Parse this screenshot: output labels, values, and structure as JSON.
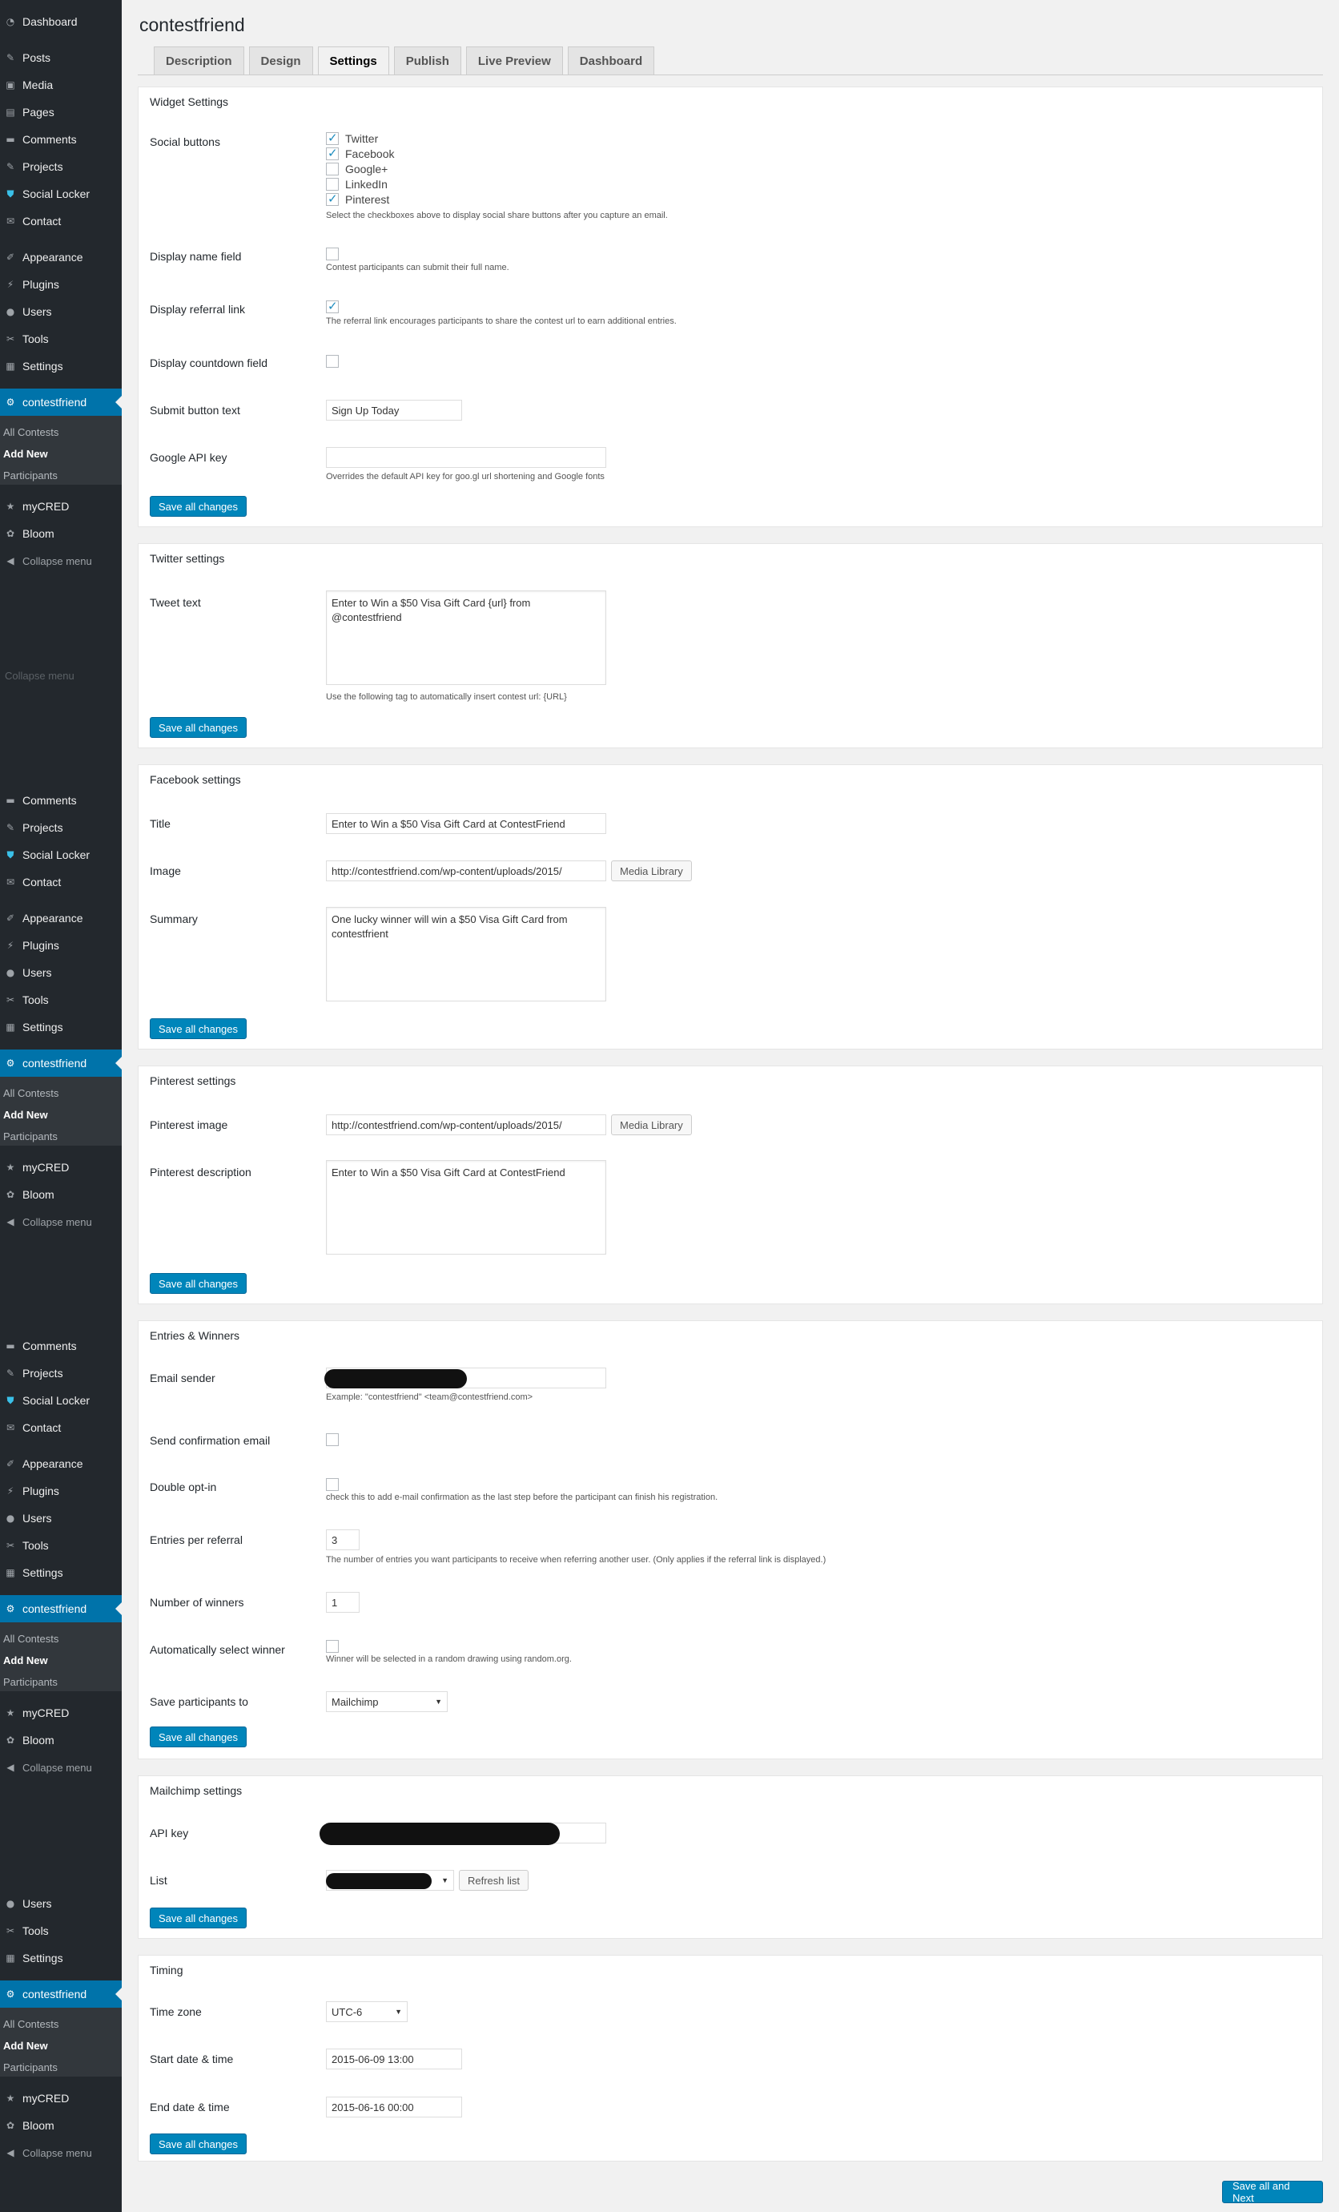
{
  "menu": {
    "dashboard": "Dashboard",
    "posts": "Posts",
    "media": "Media",
    "pages": "Pages",
    "comments": "Comments",
    "projects": "Projects",
    "social_locker": "Social Locker",
    "contact": "Contact",
    "appearance": "Appearance",
    "plugins": "Plugins",
    "users": "Users",
    "tools": "Tools",
    "settings": "Settings",
    "contestfriend": "contestfriend",
    "all_contests": "All Contests",
    "add_new": "Add New",
    "participants": "Participants",
    "mycred": "myCRED",
    "bloom": "Bloom",
    "collapse": "Collapse menu",
    "ghost_collapse": "Collapse menu"
  },
  "page": {
    "title": "contestfriend"
  },
  "tabs": [
    "Description",
    "Design",
    "Settings",
    "Publish",
    "Live Preview",
    "Dashboard"
  ],
  "save_label": "Save all changes",
  "save_next_label": "Save all and Next",
  "media_library_label": "Media Library",
  "widget": {
    "title": "Widget Settings",
    "social_buttons_label": "Social buttons",
    "social": [
      {
        "label": "Twitter",
        "checked": true
      },
      {
        "label": "Facebook",
        "checked": true
      },
      {
        "label": "Google+",
        "checked": false
      },
      {
        "label": "LinkedIn",
        "checked": false
      },
      {
        "label": "Pinterest",
        "checked": true
      }
    ],
    "social_hint": "Select the checkboxes above to display social share buttons after you capture an email.",
    "name_field_label": "Display name field",
    "name_field_hint": "Contest participants can submit their full name.",
    "referral_label": "Display referral link",
    "referral_hint": "The referral link encourages participants to share the contest url to earn additional entries.",
    "countdown_label": "Display countdown field",
    "submit_label": "Submit button text",
    "submit_value": "Sign Up Today",
    "google_api_label": "Google API key",
    "google_api_value": "",
    "google_api_hint": "Overrides the default API key for goo.gl url shortening and Google fonts"
  },
  "twitter": {
    "title": "Twitter settings",
    "tweet_label": "Tweet text",
    "tweet_value": "Enter to Win a $50 Visa Gift Card {url} from @contestfriend",
    "tweet_hint": "Use the following tag to automatically insert contest url: {URL}"
  },
  "facebook": {
    "title": "Facebook settings",
    "title_label": "Title",
    "title_value": "Enter to Win a $50 Visa Gift Card at ContestFriend",
    "image_label": "Image",
    "image_value": "http://contestfriend.com/wp-content/uploads/2015/",
    "summary_label": "Summary",
    "summary_value": "One lucky winner will win a $50 Visa Gift Card from contestfrient"
  },
  "pinterest": {
    "title": "Pinterest settings",
    "image_label": "Pinterest image",
    "image_value": "http://contestfriend.com/wp-content/uploads/2015/",
    "desc_label": "Pinterest description",
    "desc_value": "Enter to Win a $50 Visa Gift Card at ContestFriend"
  },
  "entries": {
    "title": "Entries & Winners",
    "email_sender_label": "Email sender",
    "email_sender_hint": "Example: \"contestfriend\" <team@contestfriend.com>",
    "confirm_label": "Send confirmation email",
    "optin_label": "Double opt-in",
    "optin_hint": "check this to add e-mail confirmation as the last step before the participant can finish his registration.",
    "per_referral_label": "Entries per referral",
    "per_referral_value": "3",
    "per_referral_hint": "The number of entries you want participants to receive when referring another user. (Only applies if the referral link is displayed.)",
    "winners_label": "Number of winners",
    "winners_value": "1",
    "auto_select_label": "Automatically select winner",
    "auto_select_hint": "Winner will be selected in a random drawing using random.org.",
    "save_to_label": "Save participants to",
    "save_to_value": "Mailchimp"
  },
  "mailchimp": {
    "title": "Mailchimp settings",
    "api_label": "API key",
    "list_label": "List",
    "refresh_label": "Refresh list"
  },
  "timing": {
    "title": "Timing",
    "tz_label": "Time zone",
    "tz_value": "UTC-6",
    "start_label": "Start date & time",
    "start_value": "2015-06-09 13:00",
    "end_label": "End date & time",
    "end_value": "2015-06-16 00:00"
  }
}
